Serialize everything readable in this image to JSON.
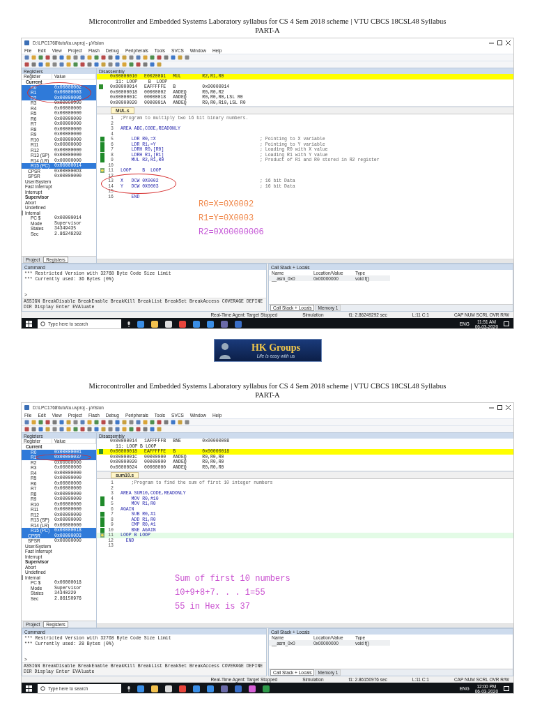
{
  "pages": [
    {
      "heading": [
        "Microcontroller and Embedded Systems Laboratory syllabus for CS 4 Sem 2018 scheme | VTU CBCS 18CSL48 Syllabus",
        "PART-A"
      ],
      "window": {
        "title": "D:\\LPC1768\\tutu\\tu.uvproj - µVision",
        "menu": [
          "File",
          "Edit",
          "View",
          "Project",
          "Flash",
          "Debug",
          "Peripherals",
          "Tools",
          "SVCS",
          "Window",
          "Help"
        ]
      },
      "registers": {
        "title": "Registers",
        "columns": [
          "Register",
          "Value"
        ],
        "group": "Current",
        "rows": [
          {
            "name": "R0",
            "value": "0x00000002",
            "selected": true,
            "kind": "reg"
          },
          {
            "name": "R1",
            "value": "0x00000003",
            "selected": true,
            "kind": "reg"
          },
          {
            "name": "R2",
            "value": "0x00000006",
            "selected": true,
            "kind": "reg"
          },
          {
            "name": "R3",
            "value": "0x00000000",
            "selected": false,
            "kind": "reg"
          },
          {
            "name": "R4",
            "value": "0x00000000",
            "selected": false,
            "kind": "reg"
          },
          {
            "name": "R5",
            "value": "0x00000000",
            "selected": false,
            "kind": "reg"
          },
          {
            "name": "R6",
            "value": "0x00000000",
            "selected": false,
            "kind": "reg"
          },
          {
            "name": "R7",
            "value": "0x00000000",
            "selected": false,
            "kind": "reg"
          },
          {
            "name": "R8",
            "value": "0x00000000",
            "selected": false,
            "kind": "reg"
          },
          {
            "name": "R9",
            "value": "0x00000000",
            "selected": false,
            "kind": "reg"
          },
          {
            "name": "R10",
            "value": "0x00000000",
            "selected": false,
            "kind": "reg"
          },
          {
            "name": "R11",
            "value": "0x00000000",
            "selected": false,
            "kind": "reg"
          },
          {
            "name": "R12",
            "value": "0x00000000",
            "selected": false,
            "kind": "reg"
          },
          {
            "name": "R13 (SP)",
            "value": "0x00000000",
            "selected": false,
            "kind": "reg"
          },
          {
            "name": "R14 (LR)",
            "value": "0x00000000",
            "selected": false,
            "kind": "reg"
          },
          {
            "name": "R15 (PC)",
            "value": "0x00000014",
            "selected": true,
            "kind": "reg"
          },
          {
            "name": "CPSR",
            "value": "0x000000D3",
            "selected": false,
            "kind": "flags"
          },
          {
            "name": "SPSR",
            "value": "0x00000000",
            "selected": false,
            "kind": "flags"
          }
        ],
        "banks": [
          {
            "label": "User/System",
            "bold": false,
            "expanded": false
          },
          {
            "label": "Fast Interrupt",
            "bold": false,
            "expanded": false
          },
          {
            "label": "Interrupt",
            "bold": false,
            "expanded": false
          },
          {
            "label": "Supervisor",
            "bold": true,
            "expanded": false
          },
          {
            "label": "Abort",
            "bold": false,
            "expanded": false
          },
          {
            "label": "Undefined",
            "bold": false,
            "expanded": false
          },
          {
            "label": "Internal",
            "bold": false,
            "expanded": true,
            "children": [
              {
                "name": "PC $",
                "value": "0x00000014"
              },
              {
                "name": "Mode",
                "value": "Supervisor"
              },
              {
                "name": "States",
                "value": "34349435"
              },
              {
                "name": "Sec",
                "value": "2.86249292"
              }
            ]
          }
        ],
        "tabs": [
          {
            "label": "Project",
            "selected": false
          },
          {
            "label": "Registers",
            "selected": true
          }
        ]
      },
      "disassembly": {
        "title": "Disassembly",
        "lines": [
          {
            "kind": "instr",
            "address": "0x00000010",
            "opcode": "E0020091",
            "mnemonic": "MUL",
            "operands": "R2,R1,R0",
            "highlighted": true,
            "marker": false
          },
          {
            "kind": "source",
            "text": "11: LOOP    B  LOOP"
          },
          {
            "kind": "instr",
            "address": "0x00000014",
            "opcode": "EAFFFFFE",
            "mnemonic": "B",
            "operands": "0x00000014",
            "highlighted": false,
            "marker": true
          },
          {
            "kind": "instr",
            "address": "0x00000018",
            "opcode": "00000002",
            "mnemonic": "ANDEQ",
            "operands": "R0,R0,R2",
            "highlighted": false,
            "marker": false
          },
          {
            "kind": "instr",
            "address": "0x0000001C",
            "opcode": "00000018",
            "mnemonic": "ANDEQ",
            "operands": "R0,R0,R0,LSL R0",
            "highlighted": false,
            "marker": false
          },
          {
            "kind": "instr",
            "address": "0x00000020",
            "opcode": "0000001A",
            "mnemonic": "ANDEQ",
            "operands": "R0,R0,R10,LSL R0",
            "highlighted": false,
            "marker": false
          }
        ]
      },
      "editor": {
        "tab": "MUL.s",
        "lines": [
          {
            "number": "1",
            "comment": ";Program to multiply two 16 bit binary numbers.",
            "executed": false,
            "current": false,
            "highlighted": false
          },
          {
            "number": "2",
            "executed": false,
            "current": false,
            "highlighted": false
          },
          {
            "number": "3",
            "code": "AREA ABC,CODE,READONLY",
            "executed": false,
            "current": false,
            "highlighted": false
          },
          {
            "number": "4",
            "executed": false,
            "current": false,
            "highlighted": false
          },
          {
            "number": "5",
            "code": "    LDR R0,=X",
            "comment": "; Pointing to X variable",
            "executed": true,
            "current": false,
            "highlighted": false
          },
          {
            "number": "6",
            "code": "    LDR R1,=Y",
            "comment": "; Pointing to Y variable",
            "executed": true,
            "current": false,
            "highlighted": false
          },
          {
            "number": "7",
            "code": "    LDRH R0,[R0]",
            "comment": "; Loading R0 with X value",
            "executed": true,
            "current": false,
            "highlighted": false
          },
          {
            "number": "8",
            "code": "    LDRH R1,[R1]",
            "comment": "; Loading R1 with Y value",
            "executed": true,
            "current": false,
            "highlighted": false
          },
          {
            "number": "9",
            "code": "    MUL R2,R1,R0",
            "comment": "; Product of R1 and R0 stored in R2 register",
            "executed": true,
            "current": false,
            "highlighted": false
          },
          {
            "number": "10",
            "executed": false,
            "current": false,
            "highlighted": false
          },
          {
            "number": "11",
            "code": "LOOP    B  LOOP",
            "executed": false,
            "current": true,
            "highlighted": false
          },
          {
            "number": "12",
            "executed": false,
            "current": false,
            "highlighted": false
          },
          {
            "number": "13",
            "code": "X   DCW 0X0002",
            "comment": "; 16 bit Data",
            "executed": false,
            "current": false,
            "highlighted": false
          },
          {
            "number": "14",
            "code": "Y   DCW 0X0003",
            "comment": "; 16 bit Data",
            "executed": false,
            "current": false,
            "highlighted": false
          },
          {
            "number": "15",
            "executed": false,
            "current": false,
            "highlighted": false
          },
          {
            "number": "16",
            "code": "    END",
            "executed": false,
            "current": false,
            "highlighted": false
          }
        ],
        "annotations": [
          {
            "text": "R0=X=0X0002",
            "color": "#f0884a"
          },
          {
            "text": "R1=Y=0X0003",
            "color": "#f0884a"
          },
          {
            "text": "R2=0X00000006",
            "color": "#c455d6"
          }
        ]
      },
      "command": {
        "title": "Command",
        "output": [
          "*** Restricted Version with 32768 Byte Code Size Limit",
          "*** Currently used: 36 Bytes (0%)"
        ],
        "prompt": ">",
        "commands": "ASSIGN BreakDisable BreakEnable BreakKill BreakList BreakSet BreakAccess COVERAGE DEFINE DIR Display Enter EVAluate"
      },
      "call_stack": {
        "title": "Call Stack + Locals",
        "columns": [
          "Name",
          "Location/Value",
          "Type"
        ],
        "rows": [
          {
            "name": "__asm_0x0",
            "location": "0x00000000",
            "type": "void f()"
          }
        ],
        "tabs": [
          {
            "label": "Call Stack + Locals",
            "selected": true
          },
          {
            "label": "Memory 1",
            "selected": false
          }
        ]
      },
      "status_bar": [
        "Real-Time Agent: Target Stopped",
        "Simulation",
        "t1: 2.86249292 sec",
        "L:11 C:1",
        "CAP NUM SCRL OVR R/W"
      ],
      "taskbar": {
        "placeholder": "Type here to search",
        "language": "ENG",
        "time": "11:51 AM",
        "date": "06-03-2020"
      }
    },
    {
      "heading": [
        "Microcontroller and Embedded Systems Laboratory syllabus for CS 4 Sem 2018 scheme | VTU CBCS 18CSL48 Syllabus",
        "PART-A"
      ],
      "window": {
        "title": "D:\\LPC1768\\tutu\\tu.uvproj - µVision",
        "menu": [
          "File",
          "Edit",
          "View",
          "Project",
          "Flash",
          "Debug",
          "Peripherals",
          "Tools",
          "SVCS",
          "Window",
          "Help"
        ]
      },
      "registers": {
        "title": "Registers",
        "columns": [
          "Register",
          "Value"
        ],
        "group": "Current",
        "rows": [
          {
            "name": "R0",
            "value": "0x00000001",
            "selected": true,
            "kind": "reg"
          },
          {
            "name": "R1",
            "value": "0x00000037",
            "selected": true,
            "kind": "reg"
          },
          {
            "name": "R2",
            "value": "0x00000000",
            "selected": false,
            "kind": "reg"
          },
          {
            "name": "R3",
            "value": "0x00000000",
            "selected": false,
            "kind": "reg"
          },
          {
            "name": "R4",
            "value": "0x00000000",
            "selected": false,
            "kind": "reg"
          },
          {
            "name": "R5",
            "value": "0x00000000",
            "selected": false,
            "kind": "reg"
          },
          {
            "name": "R6",
            "value": "0x00000000",
            "selected": false,
            "kind": "reg"
          },
          {
            "name": "R7",
            "value": "0x00000000",
            "selected": false,
            "kind": "reg"
          },
          {
            "name": "R8",
            "value": "0x00000000",
            "selected": false,
            "kind": "reg"
          },
          {
            "name": "R9",
            "value": "0x00000000",
            "selected": false,
            "kind": "reg"
          },
          {
            "name": "R10",
            "value": "0x00000000",
            "selected": false,
            "kind": "reg"
          },
          {
            "name": "R11",
            "value": "0x00000000",
            "selected": false,
            "kind": "reg"
          },
          {
            "name": "R12",
            "value": "0x00000000",
            "selected": false,
            "kind": "reg"
          },
          {
            "name": "R13 (SP)",
            "value": "0x00000000",
            "selected": false,
            "kind": "reg"
          },
          {
            "name": "R14 (LR)",
            "value": "0x00000000",
            "selected": false,
            "kind": "reg"
          },
          {
            "name": "R15 (PC)",
            "value": "0x00000018",
            "selected": true,
            "kind": "reg"
          },
          {
            "name": "CPSR",
            "value": "0x000000D3",
            "selected": true,
            "kind": "flags"
          },
          {
            "name": "SPSR",
            "value": "0x00000000",
            "selected": false,
            "kind": "flags"
          }
        ],
        "banks": [
          {
            "label": "User/System",
            "bold": false,
            "expanded": false
          },
          {
            "label": "Fast Interrupt",
            "bold": false,
            "expanded": false
          },
          {
            "label": "Interrupt",
            "bold": false,
            "expanded": false
          },
          {
            "label": "Supervisor",
            "bold": true,
            "expanded": false
          },
          {
            "label": "Abort",
            "bold": false,
            "expanded": false
          },
          {
            "label": "Undefined",
            "bold": false,
            "expanded": false
          },
          {
            "label": "Internal",
            "bold": false,
            "expanded": true,
            "children": [
              {
                "name": "PC $",
                "value": "0x00000018"
              },
              {
                "name": "Mode",
                "value": "Supervisor"
              },
              {
                "name": "States",
                "value": "34340229"
              },
              {
                "name": "Sec",
                "value": "2.86150976"
              }
            ]
          }
        ],
        "tabs": [
          {
            "label": "Project",
            "selected": false
          },
          {
            "label": "Registers",
            "selected": true
          }
        ]
      },
      "disassembly": {
        "title": "Disassembly",
        "lines": [
          {
            "kind": "instr",
            "address": "0x00000014",
            "opcode": "1AFFFFFB",
            "mnemonic": "BNE",
            "operands": "0x00000008",
            "highlighted": false,
            "marker": false
          },
          {
            "kind": "source",
            "text": "11: LOOP B LOOP"
          },
          {
            "kind": "instr",
            "address": "0x00000018",
            "opcode": "EAFFFFFE",
            "mnemonic": "B",
            "operands": "0x00000018",
            "highlighted": true,
            "marker": true
          },
          {
            "kind": "instr",
            "address": "0x0000001C",
            "opcode": "00000000",
            "mnemonic": "ANDEQ",
            "operands": "R0,R0,R0",
            "highlighted": false,
            "marker": false
          },
          {
            "kind": "instr",
            "address": "0x00000020",
            "opcode": "00000000",
            "mnemonic": "ANDEQ",
            "operands": "R0,R0,R0",
            "highlighted": false,
            "marker": false
          },
          {
            "kind": "instr",
            "address": "0x00000024",
            "opcode": "00000000",
            "mnemonic": "ANDEQ",
            "operands": "R0,R0,R0",
            "highlighted": false,
            "marker": false
          }
        ]
      },
      "editor": {
        "tab": "sum10.s",
        "lines": [
          {
            "number": "1",
            "comment": "    ;Program to find the sum of first 10 integer numbers",
            "executed": false,
            "current": false,
            "highlighted": false
          },
          {
            "number": "2",
            "executed": false,
            "current": false,
            "highlighted": false
          },
          {
            "number": "3",
            "code": "AREA SUM10,CODE,READONLY",
            "executed": false,
            "current": false,
            "highlighted": false
          },
          {
            "number": "4",
            "code": "    MOV R0,#10",
            "executed": true,
            "current": false,
            "highlighted": false
          },
          {
            "number": "5",
            "code": "    MOV R1,R0",
            "executed": true,
            "current": false,
            "highlighted": false
          },
          {
            "number": "6",
            "label": "AGAIN",
            "executed": false,
            "current": false,
            "highlighted": false
          },
          {
            "number": "7",
            "code": "    SUB R0,#1",
            "executed": true,
            "current": false,
            "highlighted": false
          },
          {
            "number": "8",
            "code": "    ADD R1,R0",
            "executed": true,
            "current": false,
            "highlighted": false
          },
          {
            "number": "9",
            "code": "    CMP R0,#1",
            "executed": true,
            "current": false,
            "highlighted": false
          },
          {
            "number": "10",
            "code": "    BNE AGAIN",
            "executed": true,
            "current": false,
            "highlighted": false
          },
          {
            "number": "11",
            "label": "LOOP B LOOP",
            "executed": false,
            "current": true,
            "highlighted": true
          },
          {
            "number": "12",
            "code": "  END",
            "executed": false,
            "current": false,
            "highlighted": false
          },
          {
            "number": "13",
            "executed": false,
            "current": false,
            "highlighted": false
          }
        ],
        "annotations": [
          {
            "text": "Sum of first 10 numbers",
            "color": "#c94fcf"
          },
          {
            "text": "10+9+8+7. . . 1=55",
            "color": "#c94fcf"
          },
          {
            "text": "55 in Hex is 37",
            "color": "#c94fcf"
          }
        ]
      },
      "command": {
        "title": "Command",
        "output": [
          "*** Restricted Version with 32768 Byte Code Size Limit",
          "*** Currently used: 28 Bytes (0%)"
        ],
        "prompt": ">",
        "commands": "ASSIGN BreakDisable BreakEnable BreakKill BreakList BreakSet BreakAccess COVERAGE DEFINE DIR Display Enter EVAluate"
      },
      "call_stack": {
        "title": "Call Stack + Locals",
        "columns": [
          "Name",
          "Location/Value",
          "Type"
        ],
        "rows": [
          {
            "name": "__asm_0x0",
            "location": "0x00000000",
            "type": "void f()"
          }
        ],
        "tabs": [
          {
            "label": "Call Stack + Locals",
            "selected": true
          },
          {
            "label": "Memory 1",
            "selected": false
          }
        ]
      },
      "status_bar": [
        "Real-Time Agent: Target Stopped",
        "Simulation",
        "t1: 2.86150976 sec",
        "L:11 C:1",
        "CAP NUM SCRL OVR R/W"
      ],
      "taskbar": {
        "placeholder": "Type here to search",
        "language": "ENG",
        "time": "12:00 PM",
        "date": "06-03-2020"
      }
    }
  ],
  "logo": {
    "name": "HK Groups",
    "tagline": "Life is easy with us"
  }
}
